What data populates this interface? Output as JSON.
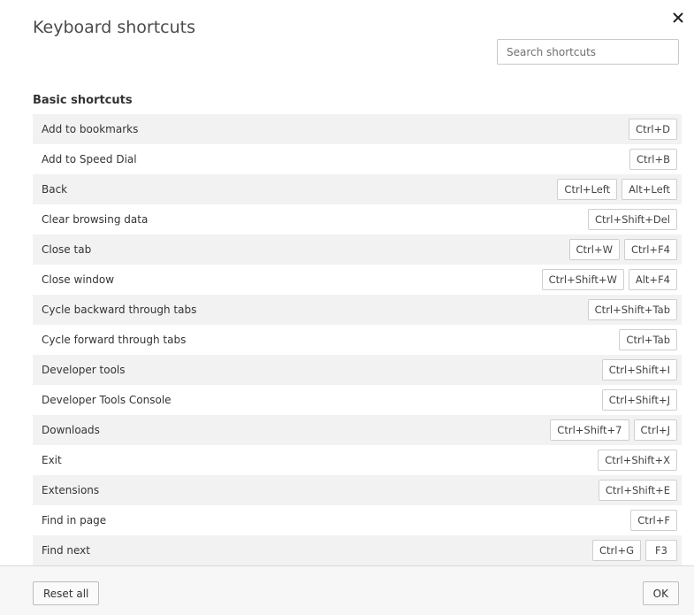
{
  "dialog": {
    "title": "Keyboard shortcuts",
    "close_icon": "close-icon",
    "search_placeholder": "Search shortcuts",
    "search_value": ""
  },
  "section": {
    "title": "Basic shortcuts"
  },
  "shortcuts": [
    {
      "label": "Add to bookmarks",
      "keys": [
        "Ctrl+D"
      ]
    },
    {
      "label": "Add to Speed Dial",
      "keys": [
        "Ctrl+B"
      ]
    },
    {
      "label": "Back",
      "keys": [
        "Ctrl+Left",
        "Alt+Left"
      ]
    },
    {
      "label": "Clear browsing data",
      "keys": [
        "Ctrl+Shift+Del"
      ]
    },
    {
      "label": "Close tab",
      "keys": [
        "Ctrl+W",
        "Ctrl+F4"
      ]
    },
    {
      "label": "Close window",
      "keys": [
        "Ctrl+Shift+W",
        "Alt+F4"
      ]
    },
    {
      "label": "Cycle backward through tabs",
      "keys": [
        "Ctrl+Shift+Tab"
      ]
    },
    {
      "label": "Cycle forward through tabs",
      "keys": [
        "Ctrl+Tab"
      ]
    },
    {
      "label": "Developer tools",
      "keys": [
        "Ctrl+Shift+I"
      ]
    },
    {
      "label": "Developer Tools Console",
      "keys": [
        "Ctrl+Shift+J"
      ]
    },
    {
      "label": "Downloads",
      "keys": [
        "Ctrl+Shift+7",
        "Ctrl+J"
      ]
    },
    {
      "label": "Exit",
      "keys": [
        "Ctrl+Shift+X"
      ]
    },
    {
      "label": "Extensions",
      "keys": [
        "Ctrl+Shift+E"
      ]
    },
    {
      "label": "Find in page",
      "keys": [
        "Ctrl+F"
      ]
    },
    {
      "label": "Find next",
      "keys": [
        "Ctrl+G",
        "F3"
      ]
    }
  ],
  "footer": {
    "reset_label": "Reset all",
    "ok_label": "OK"
  }
}
